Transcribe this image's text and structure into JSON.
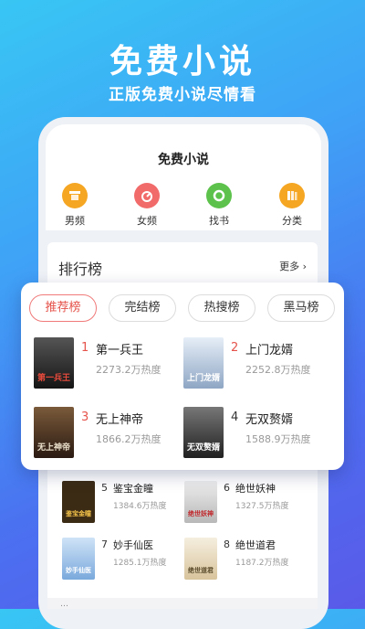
{
  "banner": {
    "headline": "免费小说",
    "subline": "正版免费小说尽情看"
  },
  "app": {
    "title": "免费小说"
  },
  "categories": [
    {
      "label": "男频",
      "icon": "male-channel-icon",
      "color": "#f5a623"
    },
    {
      "label": "女频",
      "icon": "female-channel-icon",
      "color": "#f26b6b"
    },
    {
      "label": "找书",
      "icon": "find-book-icon",
      "color": "#5cc24b"
    },
    {
      "label": "分类",
      "icon": "category-icon",
      "color": "#f5a623"
    }
  ],
  "ranking": {
    "title": "排行榜",
    "more": "更多 ›",
    "tabs": [
      "推荐榜",
      "完结榜",
      "热搜榜",
      "黑马榜"
    ],
    "active_tab": "推荐榜",
    "books": [
      {
        "rank": "1",
        "name": "第一兵王",
        "heat": "2273.2万热度",
        "cover_text": "第一兵王",
        "cover_color": "#2b2b2b"
      },
      {
        "rank": "2",
        "name": "上门龙婿",
        "heat": "2252.8万热度",
        "cover_text": "上门龙婿",
        "cover_color": "#c9d6e6"
      },
      {
        "rank": "3",
        "name": "无上神帝",
        "heat": "1866.2万热度",
        "cover_text": "无上神帝",
        "cover_color": "#3a2a22"
      },
      {
        "rank": "4",
        "name": "无双赘婿",
        "heat": "1588.9万热度",
        "cover_text": "无双赘婿",
        "cover_color": "#4a4a4a"
      }
    ],
    "rank_colors": {
      "top": "#e5534b",
      "normal": "#333333"
    }
  },
  "more_books": [
    {
      "rank": "5",
      "name": "鉴宝金瞳",
      "heat": "1384.6万热度",
      "cover_text": "鉴宝金瞳",
      "cover_color": "#3b2a14"
    },
    {
      "rank": "6",
      "name": "绝世妖神",
      "heat": "1327.5万热度",
      "cover_text": "绝世妖神",
      "cover_color": "#d9d9d9"
    },
    {
      "rank": "7",
      "name": "妙手仙医",
      "heat": "1285.1万热度",
      "cover_text": "妙手仙医",
      "cover_color": "#9cc3e8"
    },
    {
      "rank": "8",
      "name": "绝世道君",
      "heat": "1187.2万热度",
      "cover_text": "绝世道君",
      "cover_color": "#e8dcc4"
    }
  ],
  "footer_hint": "…"
}
